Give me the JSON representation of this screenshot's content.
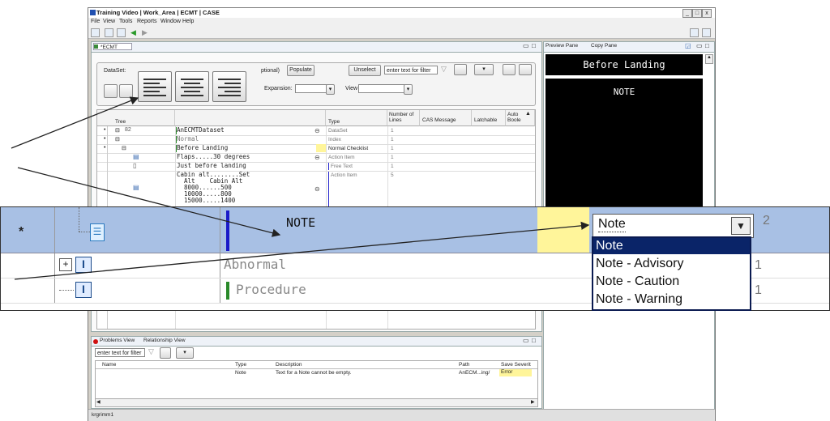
{
  "window": {
    "title": "Training Video | Work_Area | ECMT | CASE",
    "menu": [
      "File",
      "View",
      "Tools",
      "Reports",
      "Window",
      "Help"
    ]
  },
  "editor": {
    "tab_label": "*ECMT Editor",
    "dataset_label": "DataSet:",
    "optional_label": "ptional)",
    "populate_button": "Populate",
    "unselect_button": "Unselect",
    "filter_placeholder": "enter text for filter",
    "expansion_label": "Expansion:",
    "view_label": "View",
    "columns": {
      "tree": "Tree",
      "type": "Type",
      "number_of_lines": "Number of Lines",
      "cas_message": "CAS Message",
      "latchable": "Latchable",
      "auto_boole": "Auto Boole"
    },
    "rows": [
      {
        "tree_label": "82",
        "name": "AnECMTDataset",
        "type": "DataSet",
        "lines": "1"
      },
      {
        "tree_label": "",
        "name": "Normal",
        "type": "Index",
        "lines": "1"
      },
      {
        "tree_label": "",
        "name": "Before Landing",
        "type": "Normal Checklist",
        "lines": "1"
      },
      {
        "tree_label": "",
        "name": "Flaps.....30 degrees",
        "type": "Action Item",
        "lines": "1"
      },
      {
        "tree_label": "",
        "name": "Just before landing",
        "type": "Free Text",
        "lines": "1"
      },
      {
        "tree_label": "",
        "name": "Cabin alt........Set\n  Alt    Cabin Alt\n  8000......500\n  10000.....800\n  15000.....1400",
        "type": "Action Item",
        "lines": "5"
      }
    ]
  },
  "preview": {
    "tab_label": "Preview Pane",
    "copy_tab_label": "Copy Pane",
    "title_text": "Before Landing",
    "note_text": "NOTE"
  },
  "zoom": {
    "row_marker": "*",
    "selected_name": "NOTE",
    "dropdown_value": "Note",
    "dropdown_options": [
      "Note",
      "Note - Advisory",
      "Note - Caution",
      "Note - Warning"
    ],
    "selected_lines": "2",
    "row2_name": "Abnormal",
    "row2_lines": "1",
    "row3_name": "Procedure",
    "row3_lines": "1"
  },
  "problems": {
    "tab_label": "Problems View",
    "relationship_tab_label": "Relationship View",
    "filter_placeholder": "enter text for filter",
    "columns": {
      "name": "Name",
      "type": "Type",
      "description": "Description",
      "path": "Path",
      "severity": "Save Severit"
    },
    "rows": [
      {
        "name": "",
        "type": "Note",
        "description": "Text for a Note cannot be empty.",
        "path": "AnECM...ing/",
        "severity": "Error"
      }
    ]
  },
  "status_text": "krgrimm1",
  "colors": {
    "selected_row": "#a8c0e4",
    "highlight_yellow": "#fff59a",
    "error_dot": "#d01010",
    "dropdown_selected": "#0a2468"
  }
}
